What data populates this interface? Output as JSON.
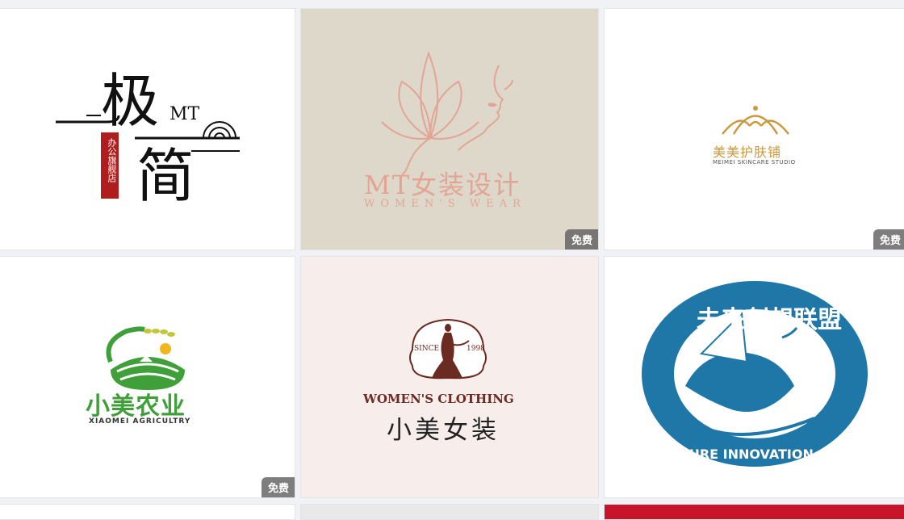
{
  "cards": [
    {
      "badge": "",
      "logo": {
        "char_top": "极",
        "char_bottom": "简",
        "mark": "MT",
        "seal_text": "办公旗舰店"
      }
    },
    {
      "badge": "免费",
      "logo": {
        "title": "MT女装设计",
        "subtitle": "WOMEN'S WEAR"
      }
    },
    {
      "badge": "免费",
      "logo": {
        "title": "美美护肤铺",
        "subtitle": "MEIMEI SKINCARE STUDIO"
      }
    },
    {
      "badge": "免费",
      "logo": {
        "title": "小美农业",
        "subtitle": "XIAOMEI AGRICULTRY"
      }
    },
    {
      "badge": "",
      "logo": {
        "since": "SINCE",
        "year": "1998",
        "title_en": "WOMEN'S CLOTHING",
        "title_cn": "小美女装"
      }
    },
    {
      "badge": "",
      "logo": {
        "arc_cn": "未来创想联盟",
        "arc_en": "FUTURE INNOVATION ALLIANCE"
      }
    }
  ],
  "colors": {
    "card2_bg": "#ddd8c9",
    "card2_accent": "#e3a496",
    "card3_gold": "#c9993f",
    "card4_green": "#3fa03a",
    "card5_bg": "#f7eeec",
    "card5_brown": "#6b2b23",
    "card6_blue": "#1f77a8"
  }
}
